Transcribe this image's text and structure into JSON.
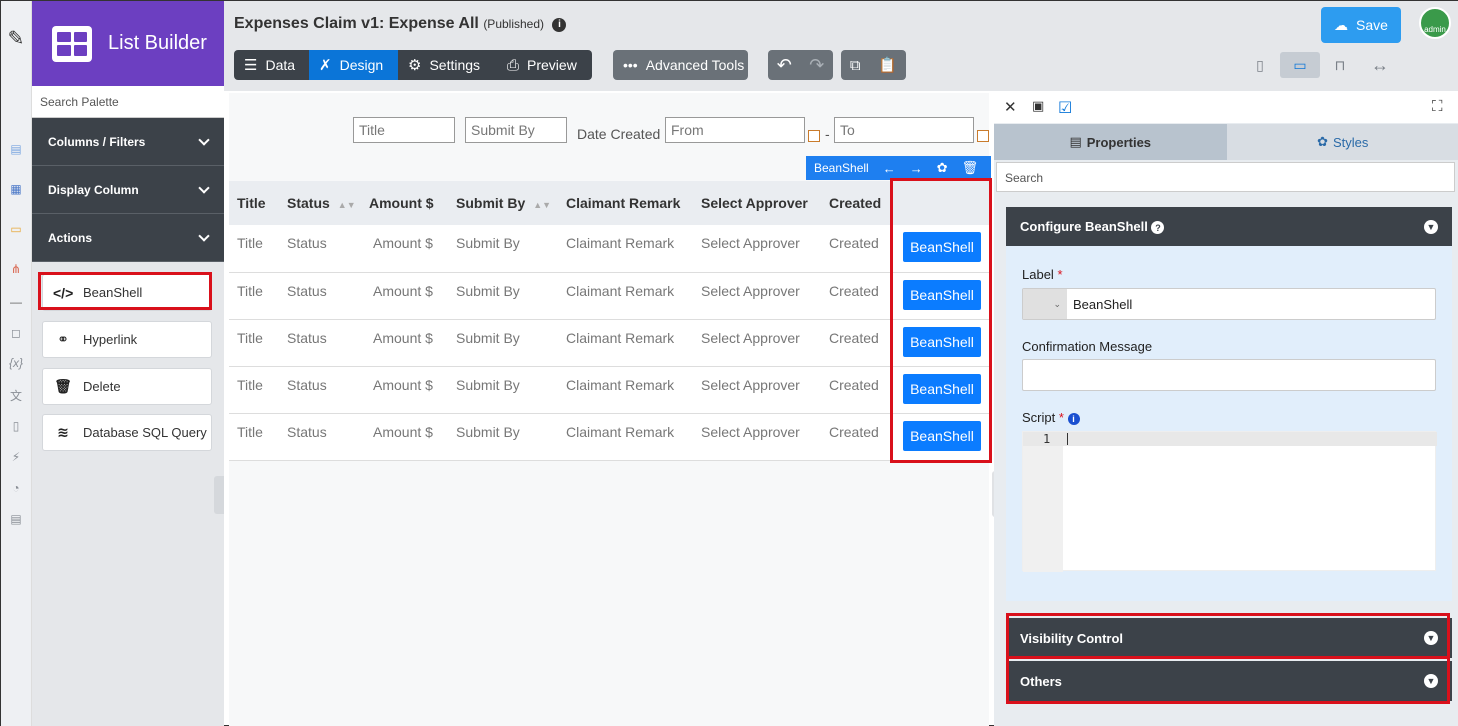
{
  "app": {
    "name": "List Builder"
  },
  "header": {
    "title": "Expenses Claim v1: Expense All",
    "status": "(Published)",
    "tabs": [
      {
        "label": "Data",
        "icon": "data-icon"
      },
      {
        "label": "Design",
        "icon": "design-icon"
      },
      {
        "label": "Settings",
        "icon": "gear-icon"
      },
      {
        "label": "Preview",
        "icon": "preview-icon"
      }
    ],
    "advanced_tools": "Advanced Tools",
    "save_label": "Save",
    "avatar_text": "admin"
  },
  "palette": {
    "search_placeholder": "Search Palette",
    "sections": [
      "Columns / Filters",
      "Display Column",
      "Actions"
    ],
    "actions": [
      {
        "label": "BeanShell",
        "icon": "code-icon"
      },
      {
        "label": "Hyperlink",
        "icon": "link-icon"
      },
      {
        "label": "Delete",
        "icon": "trash-icon"
      },
      {
        "label": "Database SQL Query",
        "icon": "database-icon"
      }
    ]
  },
  "filters": {
    "title_placeholder": "Title",
    "submit_by_placeholder": "Submit By",
    "date_created_label": "Date Created",
    "from_placeholder": "From",
    "dash": "-",
    "to_placeholder": "To"
  },
  "selected_toolbar": {
    "label": "BeanShell"
  },
  "table": {
    "columns": [
      "Title",
      "Status",
      "Amount $",
      "Submit By",
      "Claimant Remark",
      "Select Approver",
      "Created"
    ],
    "rows": [
      [
        "Title",
        "Status",
        "Amount $",
        "Submit By",
        "Claimant Remark",
        "Select Approver",
        "Created"
      ],
      [
        "Title",
        "Status",
        "Amount $",
        "Submit By",
        "Claimant Remark",
        "Select Approver",
        "Created"
      ],
      [
        "Title",
        "Status",
        "Amount $",
        "Submit By",
        "Claimant Remark",
        "Select Approver",
        "Created"
      ],
      [
        "Title",
        "Status",
        "Amount $",
        "Submit By",
        "Claimant Remark",
        "Select Approver",
        "Created"
      ],
      [
        "Title",
        "Status",
        "Amount $",
        "Submit By",
        "Claimant Remark",
        "Select Approver",
        "Created"
      ]
    ],
    "action_label": "BeanShell"
  },
  "properties": {
    "tabs": [
      "Properties",
      "Styles"
    ],
    "search_placeholder": "Search",
    "configure_title": "Configure BeanShell",
    "label_label": "Label",
    "label_value": "BeanShell",
    "confirmation_label": "Confirmation Message",
    "confirmation_value": "",
    "script_label": "Script",
    "line_number": "1",
    "sections": [
      "Visibility Control",
      "Others"
    ]
  }
}
